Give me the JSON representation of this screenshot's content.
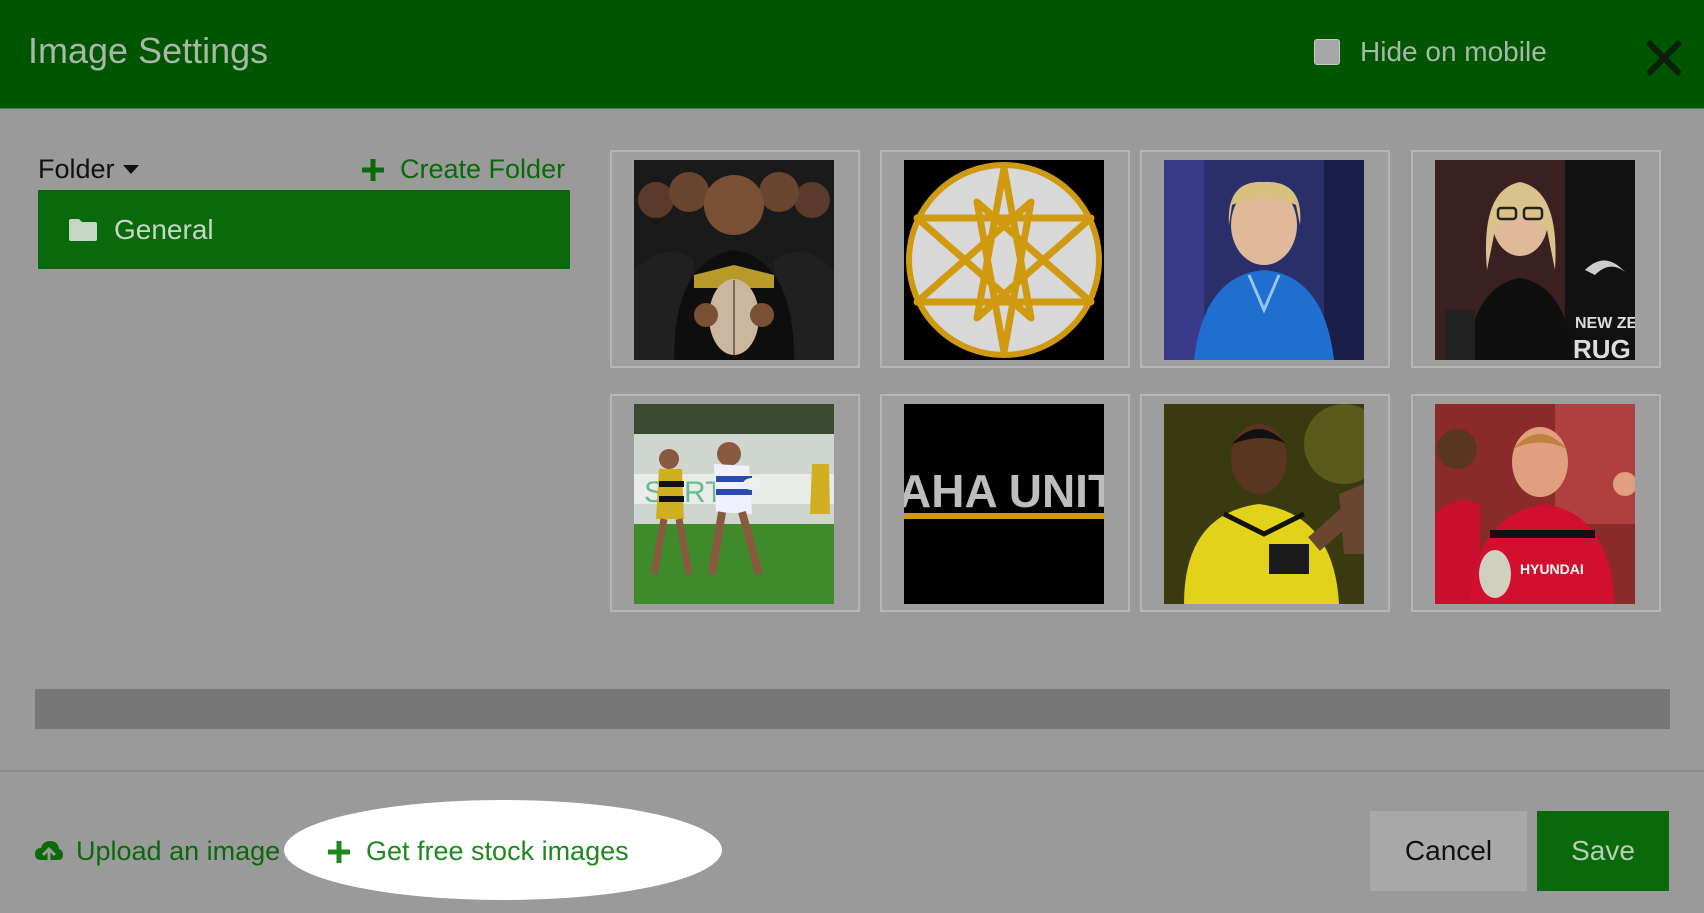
{
  "header": {
    "title": "Image Settings",
    "hide_mobile_label": "Hide on mobile"
  },
  "sidebar": {
    "folder_dropdown_label": "Folder",
    "create_folder_label": "Create Folder",
    "folders": [
      {
        "label": "General",
        "selected": true
      }
    ]
  },
  "gallery": {
    "images": [
      {
        "description": "rugby-team-player-holding-ball"
      },
      {
        "description": "gold-star-logo"
      },
      {
        "description": "woman-blue-blouse-portrait"
      },
      {
        "description": "woman-glasses-new-zealand-rugby"
      },
      {
        "description": "womens-rugby-match"
      },
      {
        "description": "aha-united-logo-banner",
        "text": "AHA UNIT"
      },
      {
        "description": "rugby-player-yellow-jersey"
      },
      {
        "description": "rugby-players-red-jersey"
      }
    ]
  },
  "footer": {
    "upload_label": "Upload an image",
    "stock_label": "Get free stock images",
    "cancel_label": "Cancel",
    "save_label": "Save"
  },
  "colors": {
    "header_bg": "#005500",
    "accent_green": "#0a6a0a",
    "overlay_gray": "#9a9a9a"
  },
  "icons": {
    "close": "close-icon",
    "plus": "plus-icon",
    "folder": "folder-icon",
    "upload": "cloud-upload-icon"
  }
}
